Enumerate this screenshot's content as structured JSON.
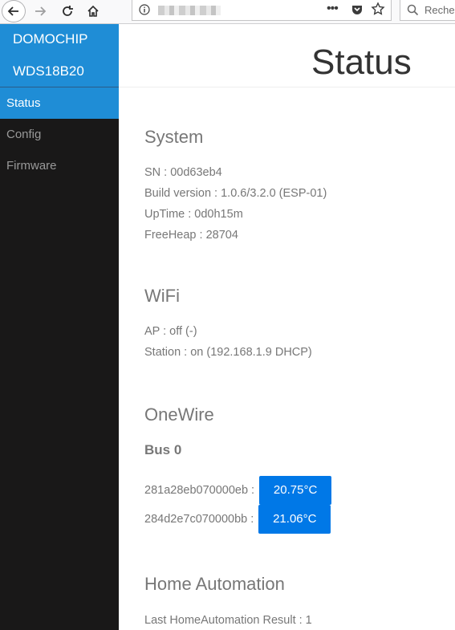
{
  "browser": {
    "search_placeholder": "Reche"
  },
  "sidebar": {
    "brand": [
      "DOMOCHIP",
      "WDS18B20"
    ],
    "items": [
      {
        "label": "Status"
      },
      {
        "label": "Config"
      },
      {
        "label": "Firmware"
      }
    ]
  },
  "header": {
    "title": "Status"
  },
  "system": {
    "title": "System",
    "sn": "SN : 00d63eb4",
    "build": "Build version : 1.0.6/3.2.0 (ESP-01)",
    "uptime": "UpTime : 0d0h15m",
    "freeheap": "FreeHeap : 28704"
  },
  "wifi": {
    "title": "WiFi",
    "ap": "AP : off (-)",
    "station": "Station : on (192.168.1.9 DHCP)"
  },
  "onewire": {
    "title": "OneWire",
    "bus": "Bus 0",
    "sensors": [
      {
        "id": "281a28eb070000eb :",
        "temp": "20.75°C"
      },
      {
        "id": "284d2e7c070000bb :",
        "temp": "21.06°C"
      }
    ]
  },
  "home_automation": {
    "title": "Home Automation",
    "last_result": "Last HomeAutomation Result : 1"
  },
  "colors": {
    "accent": "#1f8dd6",
    "button": "#0078e7",
    "sidebar_bg": "#191818"
  }
}
